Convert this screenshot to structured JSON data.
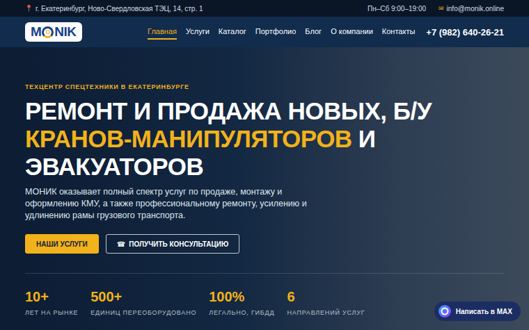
{
  "topbar": {
    "address_icon": "📍",
    "address": "г. Екатеринбург, Ново-Свердловская ТЭЦ, 14, стр. 1",
    "hours": "Пн–Сб 9:00–19:00",
    "email_icon": "✉",
    "email": "info@monik.online"
  },
  "logo": {
    "before": "M",
    "mark": "O",
    "after": "NIK"
  },
  "nav": {
    "items": [
      {
        "label": "Главная",
        "selected": true
      },
      {
        "label": "Услуги",
        "selected": false
      },
      {
        "label": "Каталог",
        "selected": false
      },
      {
        "label": "Портфолио",
        "selected": false
      },
      {
        "label": "Блог",
        "selected": false
      },
      {
        "label": "О компании",
        "selected": false
      },
      {
        "label": "Контакты",
        "selected": false
      }
    ],
    "phone": "+7 (982) 640-26-21"
  },
  "hero": {
    "eyebrow": "ТЕХЦЕНТР СПЕЦТЕХНИКИ В ЕКАТЕРИНБУРГЕ",
    "title_lines": [
      [
        {
          "text": "РЕМОНТ И ПРОДАЖА НОВЫХ, Б/У",
          "accent": false
        }
      ],
      [
        {
          "text": "КРАНОВ-МАНИПУЛЯТОРОВ",
          "accent": true
        },
        {
          "text": " И",
          "accent": false
        }
      ],
      [
        {
          "text": "ЭВАКУАТОРОВ",
          "accent": false
        }
      ]
    ],
    "description": "МОНИК оказывает полный спектр услуг по продаже, монтажу и оформлению КМУ, а также профессиональному ремонту, усилению и удлинению рамы грузового транспорта.",
    "buttons": [
      {
        "label": "НАШИ УСЛУГИ",
        "kind": "primary",
        "icon": ""
      },
      {
        "label": "ПОЛУЧИТЬ КОНСУЛЬТАЦИЮ",
        "kind": "outline",
        "icon": "☎"
      }
    ]
  },
  "stats": [
    {
      "value": "10+",
      "label": "ЛЕТ НА РЫНКЕ"
    },
    {
      "value": "500+",
      "label": "ЕДИНИЦ ПЕРЕОБОРУДОВАНО"
    },
    {
      "value": "100%",
      "label": "ЛЕГАЛЬНО, ГИБДД"
    },
    {
      "value": "6",
      "label": "НАПРАВЛЕНИЙ УСЛУГ"
    }
  ],
  "chat": {
    "label": "Написать в MAX"
  }
}
